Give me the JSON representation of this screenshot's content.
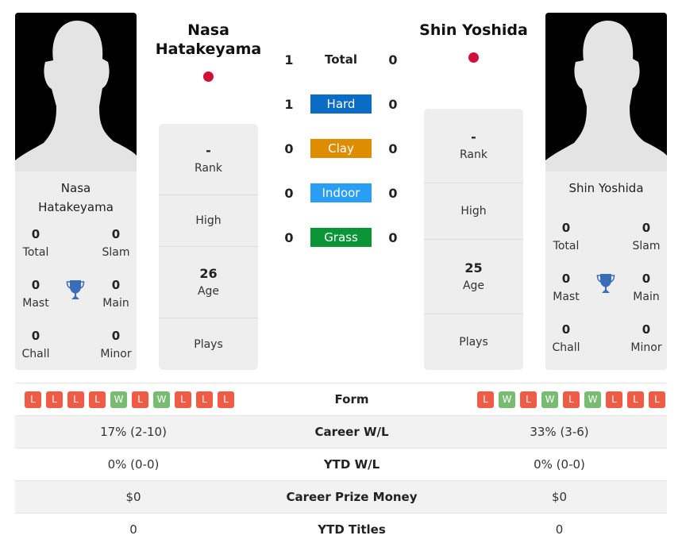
{
  "player_left": {
    "name": "Nasa Hatakeyama",
    "name_line1": "Nasa",
    "name_line2": "Hatakeyama",
    "flag_color": "#d0103a",
    "titles": {
      "total": "0",
      "total_label": "Total",
      "slam": "0",
      "slam_label": "Slam",
      "mast": "0",
      "mast_label": "Mast",
      "main": "0",
      "main_label": "Main",
      "chall": "0",
      "chall_label": "Chall",
      "minor": "0",
      "minor_label": "Minor"
    },
    "info": {
      "rank_value": "-",
      "rank_label": "Rank",
      "high_label": "High",
      "age_value": "26",
      "age_label": "Age",
      "plays_label": "Plays"
    }
  },
  "player_right": {
    "name": "Shin Yoshida",
    "flag_color": "#d0103a",
    "titles": {
      "total": "0",
      "total_label": "Total",
      "slam": "0",
      "slam_label": "Slam",
      "mast": "0",
      "mast_label": "Mast",
      "main": "0",
      "main_label": "Main",
      "chall": "0",
      "chall_label": "Chall",
      "minor": "0",
      "minor_label": "Minor"
    },
    "info": {
      "rank_value": "-",
      "rank_label": "Rank",
      "high_label": "High",
      "age_value": "25",
      "age_label": "Age",
      "plays_label": "Plays"
    }
  },
  "h2h": {
    "rows": [
      {
        "label": "Total",
        "left": "1",
        "right": "0",
        "color": ""
      },
      {
        "label": "Hard",
        "left": "1",
        "right": "0",
        "color": "#0a6cc4"
      },
      {
        "label": "Clay",
        "left": "0",
        "right": "0",
        "color": "#df8d00"
      },
      {
        "label": "Indoor",
        "left": "0",
        "right": "0",
        "color": "#2a9df4"
      },
      {
        "label": "Grass",
        "left": "0",
        "right": "0",
        "color": "#0a9637"
      }
    ]
  },
  "stats": {
    "form_label": "Form",
    "form_left": [
      "L",
      "L",
      "L",
      "L",
      "W",
      "L",
      "W",
      "L",
      "L",
      "L"
    ],
    "form_right": [
      "L",
      "W",
      "L",
      "W",
      "L",
      "W",
      "L",
      "L",
      "L"
    ],
    "rows": [
      {
        "label": "Career W/L",
        "left": "17% (2-10)",
        "right": "33% (3-6)"
      },
      {
        "label": "YTD W/L",
        "left": "0% (0-0)",
        "right": "0% (0-0)"
      },
      {
        "label": "Career Prize Money",
        "left": "$0",
        "right": "$0"
      },
      {
        "label": "YTD Titles",
        "left": "0",
        "right": "0"
      }
    ]
  },
  "colors": {
    "loss": "#ef5b44",
    "win": "#78bb72",
    "trophy": "#3a6db8"
  }
}
